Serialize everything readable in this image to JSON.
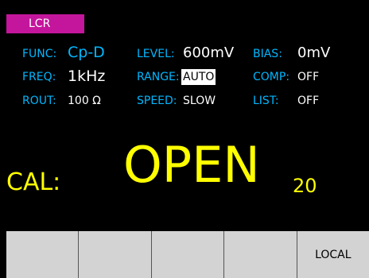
{
  "tab": {
    "label": "LCR"
  },
  "params": {
    "func": {
      "label": "FUNC:",
      "value": "Cp-D"
    },
    "freq": {
      "label": "FREQ:",
      "value": "1kHz"
    },
    "rout": {
      "label": "ROUT:",
      "value": "100 Ω"
    },
    "level": {
      "label": "LEVEL:",
      "value": "600mV"
    },
    "range": {
      "label": "RANGE:",
      "value": "AUTO"
    },
    "speed": {
      "label": "SPEED:",
      "value": "SLOW"
    },
    "bias": {
      "label": "BIAS:",
      "value": "0mV"
    },
    "comp": {
      "label": "COMP:",
      "value": "OFF"
    },
    "list": {
      "label": "LIST:",
      "value": "OFF"
    }
  },
  "cal": {
    "label": "CAL:",
    "status": "OPEN",
    "count": "20"
  },
  "softkeys": [
    "",
    "",
    "",
    "",
    "LOCAL"
  ],
  "colors": {
    "label": "#00b7ff",
    "value": "#ffffff",
    "status": "#ffff00",
    "tab": "#c4169c",
    "softkey": "#d3d3d3"
  }
}
